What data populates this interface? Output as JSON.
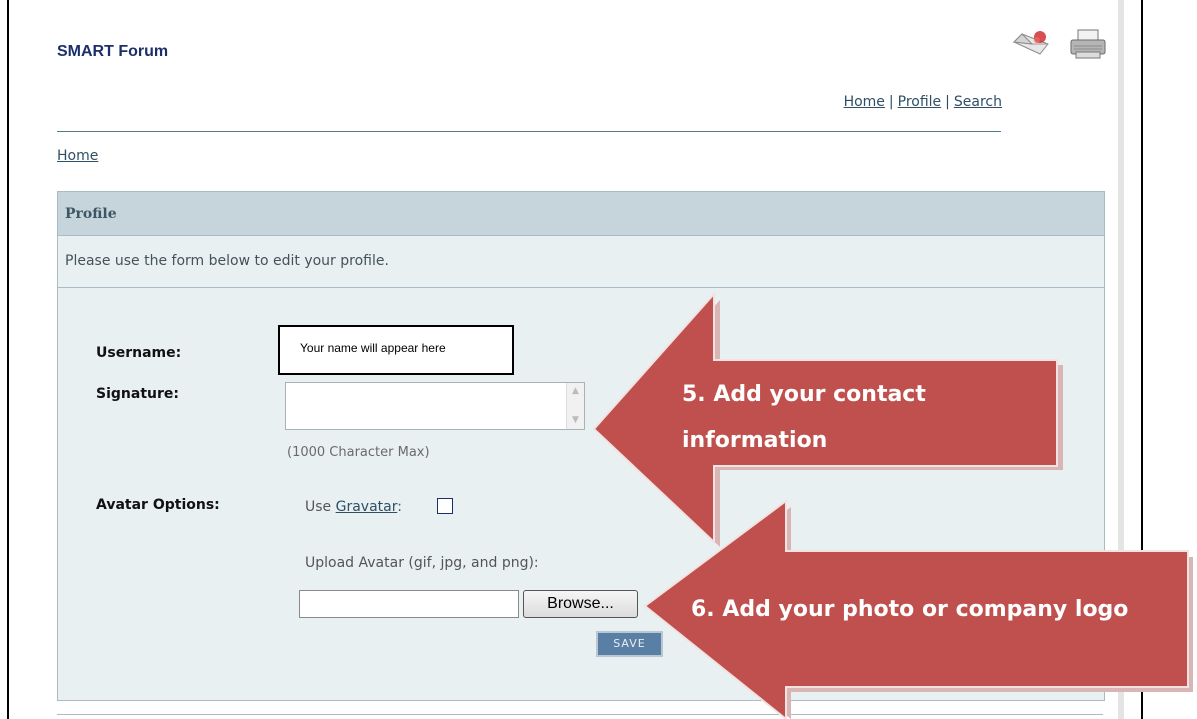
{
  "header": {
    "title": "SMART Forum",
    "icons": [
      "mail-icon",
      "printer-icon"
    ]
  },
  "topnav": {
    "home": "Home",
    "sep1": "|",
    "profile": "Profile",
    "sep2": "|",
    "search": "Search"
  },
  "breadcrumb": {
    "home": "Home"
  },
  "panel": {
    "heading": "Profile",
    "subtitle": "Please use the form below to edit your profile."
  },
  "form": {
    "username_label": "Username:",
    "username_value": "Your name will appear here",
    "signature_label": "Signature:",
    "signature_value": "",
    "signature_hint": "(1000 Character Max)",
    "avatar_label": "Avatar Options:",
    "use_prefix": "Use",
    "gravatar_link": "Gravatar",
    "use_suffix": ":",
    "gravatar_checked": false,
    "upload_label": "Upload Avatar (gif, jpg, and png):",
    "file_value": "",
    "browse_label": "Browse...",
    "save_label": "SAVE"
  },
  "callouts": {
    "step5_line1": "5. Add your contact",
    "step5_line2": "information",
    "step6": "6. Add your photo or company logo",
    "color": "#c0504d"
  }
}
